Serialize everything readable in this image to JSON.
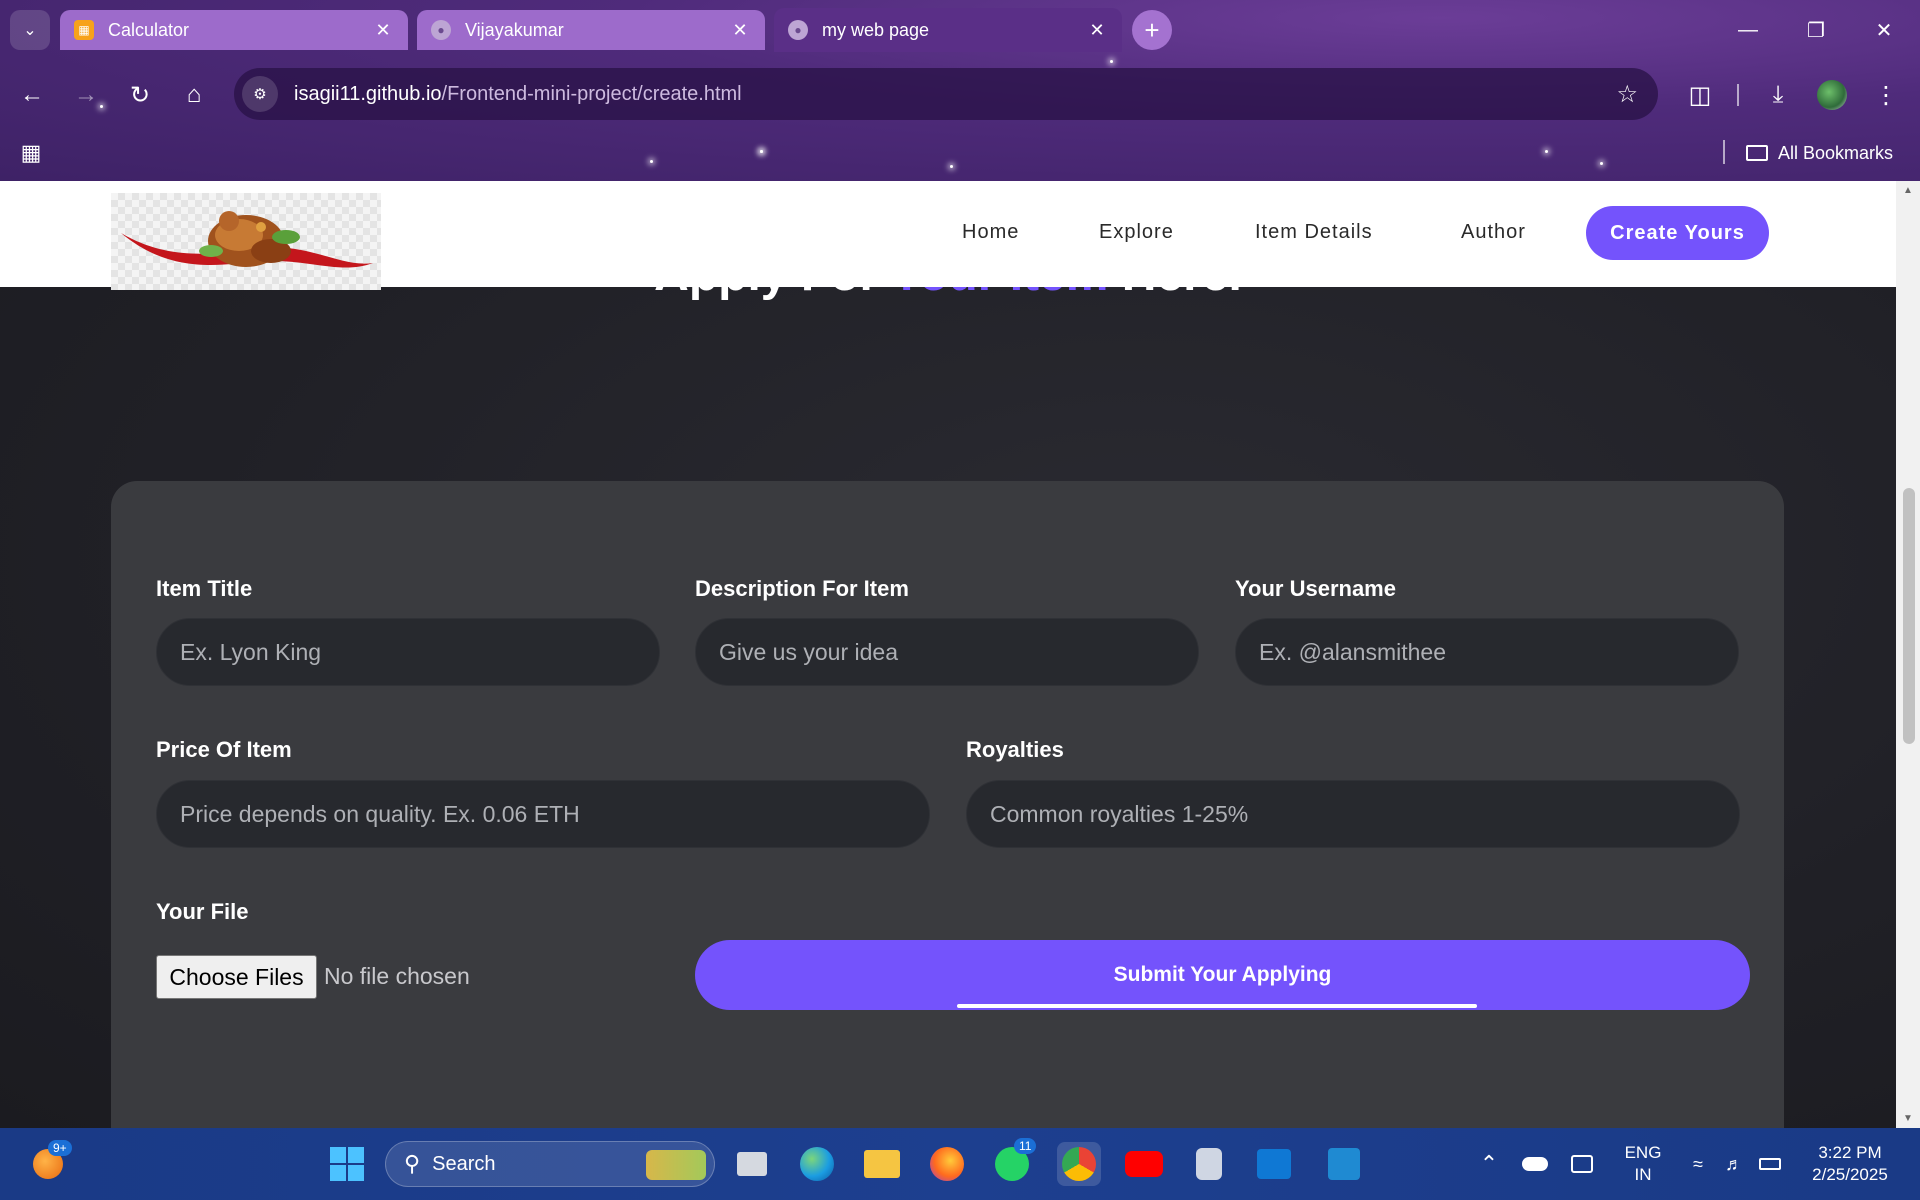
{
  "browser": {
    "tabs": [
      {
        "title": "Calculator",
        "active": false
      },
      {
        "title": "Vijayakumar",
        "active": false
      },
      {
        "title": "my web page",
        "active": true
      }
    ],
    "url_host": "isagii11.github.io",
    "url_path": "/Frontend-mini-project/create.html",
    "bookmarks_label": "All Bookmarks",
    "theme_color": "#4f2b7b"
  },
  "site": {
    "nav": {
      "home": "Home",
      "explore": "Explore",
      "item_details": "Item Details",
      "author": "Author",
      "cta": "Create Yours"
    },
    "heading": {
      "before": "Apply For ",
      "highlight": "Your Item",
      "after": " Here."
    },
    "accent_color": "#7453fc",
    "form": {
      "item_title_label": "Item Title",
      "item_title_placeholder": "Ex. Lyon King",
      "description_label": "Description For Item",
      "description_placeholder": "Give us your idea",
      "username_label": "Your Username",
      "username_placeholder": "Ex. @alansmithee",
      "price_label": "Price Of Item",
      "price_placeholder": "Price depends on quality. Ex. 0.06 ETH",
      "royalties_label": "Royalties",
      "royalties_placeholder": "Common royalties 1-25%",
      "file_label": "Your File",
      "file_button": "Choose Files",
      "file_status": "No file chosen",
      "submit": "Submit Your Applying"
    }
  },
  "taskbar": {
    "search_label": "Search",
    "notification_badge": "9+",
    "whatsapp_badge": "11",
    "lang_line1": "ENG",
    "lang_line2": "IN",
    "time": "3:22 PM",
    "date": "2/25/2025"
  }
}
